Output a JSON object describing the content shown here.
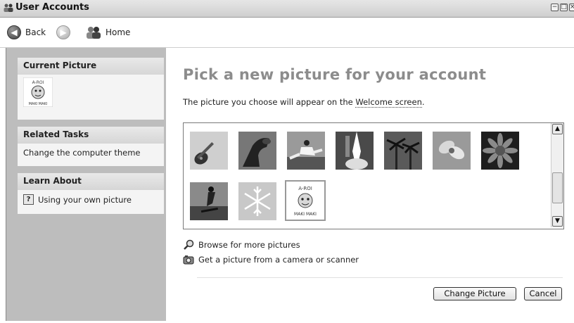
{
  "window": {
    "title": "User Accounts"
  },
  "nav": {
    "back_label": "Back",
    "home_label": "Home"
  },
  "sidebar": {
    "current_picture": {
      "header": "Current Picture",
      "picture_caption": "MAKI MAKI",
      "picture_banner": "A-ROI"
    },
    "related_tasks": {
      "header": "Related Tasks",
      "items": [
        {
          "label": "Change the computer theme"
        }
      ]
    },
    "learn_about": {
      "header": "Learn About",
      "items": [
        {
          "label": "Using your own picture"
        }
      ]
    }
  },
  "main": {
    "heading": "Pick a new picture for your account",
    "description_prefix": "The picture you choose will appear on the ",
    "description_link": "Welcome screen",
    "description_suffix": ".",
    "gallery": {
      "pictures": [
        {
          "name": "guitar"
        },
        {
          "name": "horse"
        },
        {
          "name": "karate"
        },
        {
          "name": "space-shuttle"
        },
        {
          "name": "palm-trees"
        },
        {
          "name": "flower"
        },
        {
          "name": "daisy"
        },
        {
          "name": "skateboarder"
        },
        {
          "name": "snowflake"
        },
        {
          "name": "maki-maki",
          "caption": "MAKI MAKI",
          "banner": "A-ROI",
          "selected": true
        }
      ]
    },
    "options": [
      {
        "label": "Browse for more pictures",
        "icon": "magnifier-icon"
      },
      {
        "label": "Get a picture from a camera or scanner",
        "icon": "camera-icon"
      }
    ],
    "buttons": {
      "change_picture": "Change Picture",
      "cancel": "Cancel"
    }
  }
}
